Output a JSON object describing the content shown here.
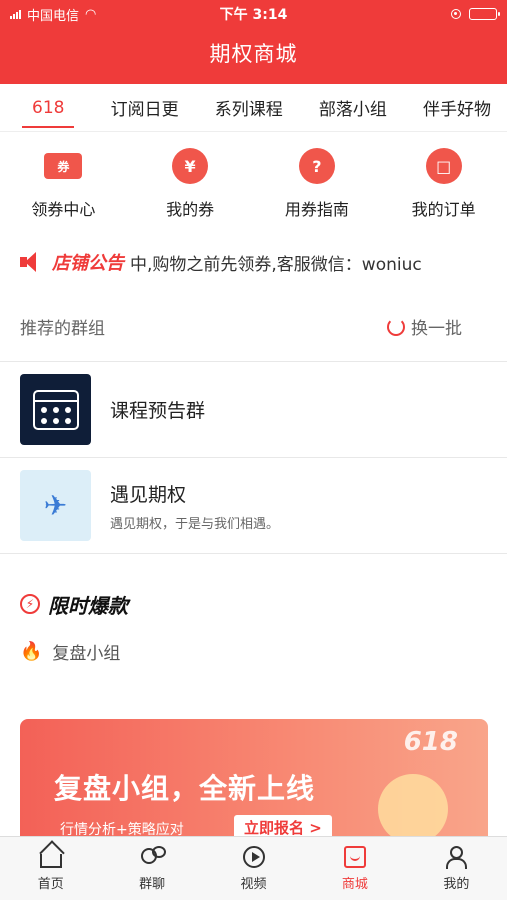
{
  "status_bar": {
    "carrier": "中国电信",
    "time": "下午 3:14"
  },
  "header": {
    "title": "期权商城"
  },
  "tabs": [
    {
      "label": "618",
      "active": true
    },
    {
      "label": "订阅日更"
    },
    {
      "label": "系列课程"
    },
    {
      "label": "部落小组"
    },
    {
      "label": "伴手好物"
    }
  ],
  "quick_links": [
    {
      "label": "领券中心",
      "icon": "coupon-center-icon",
      "glyph": "券"
    },
    {
      "label": "我的券",
      "icon": "my-coupon-icon",
      "glyph": "¥"
    },
    {
      "label": "用券指南",
      "icon": "guide-icon",
      "glyph": "?"
    },
    {
      "label": "我的订单",
      "icon": "order-icon",
      "glyph": "□"
    }
  ],
  "notice": {
    "title": "店铺公告",
    "text": "中,购物之前先领券,客服微信：woniuc"
  },
  "recommended": {
    "title": "推荐的群组",
    "refresh_label": "换一批",
    "groups": [
      {
        "name": "课程预告群",
        "desc": ""
      },
      {
        "name": "遇见期权",
        "desc": "遇见期权，于是与我们相遇。"
      }
    ]
  },
  "flash_sale": {
    "title": "限时爆款",
    "section_title": "复盘小组",
    "banner": {
      "badge": "618",
      "headline": "复盘小组，全新上线",
      "subtext": "行情分析+策略应对",
      "button": "立即报名 >"
    }
  },
  "tabbar": [
    {
      "label": "首页",
      "icon": "home-icon"
    },
    {
      "label": "群聊",
      "icon": "group-chat-icon"
    },
    {
      "label": "视频",
      "icon": "video-icon"
    },
    {
      "label": "商城",
      "icon": "shop-icon",
      "active": true
    },
    {
      "label": "我的",
      "icon": "user-icon"
    }
  ],
  "colors": {
    "accent": "#ef3b3a"
  }
}
